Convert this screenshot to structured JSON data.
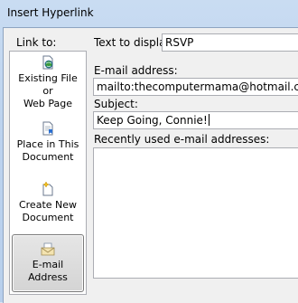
{
  "window": {
    "title": "Insert Hyperlink"
  },
  "link_to": {
    "label": "Link to:",
    "items": [
      {
        "line1": "Existing File or",
        "line2": "Web Page",
        "icon": "globe-file-icon",
        "selected": false
      },
      {
        "line1": "Place in This",
        "line2": "Document",
        "icon": "document-bookmark-icon",
        "selected": false
      },
      {
        "line1": "Create New",
        "line2": "Document",
        "icon": "new-document-icon",
        "selected": false
      },
      {
        "line1": "E-mail Address",
        "line2": "",
        "icon": "envelope-icon",
        "selected": true
      }
    ]
  },
  "form": {
    "text_to_display_label": "Text to display:",
    "text_to_display_value": "RSVP",
    "email_label": "E-mail address:",
    "email_value": "mailto:thecomputermama@hotmail.com",
    "subject_label": "Subject:",
    "subject_value": "Keep Going, Connie!",
    "recent_label": "Recently used e-mail addresses:",
    "recent_items": []
  }
}
